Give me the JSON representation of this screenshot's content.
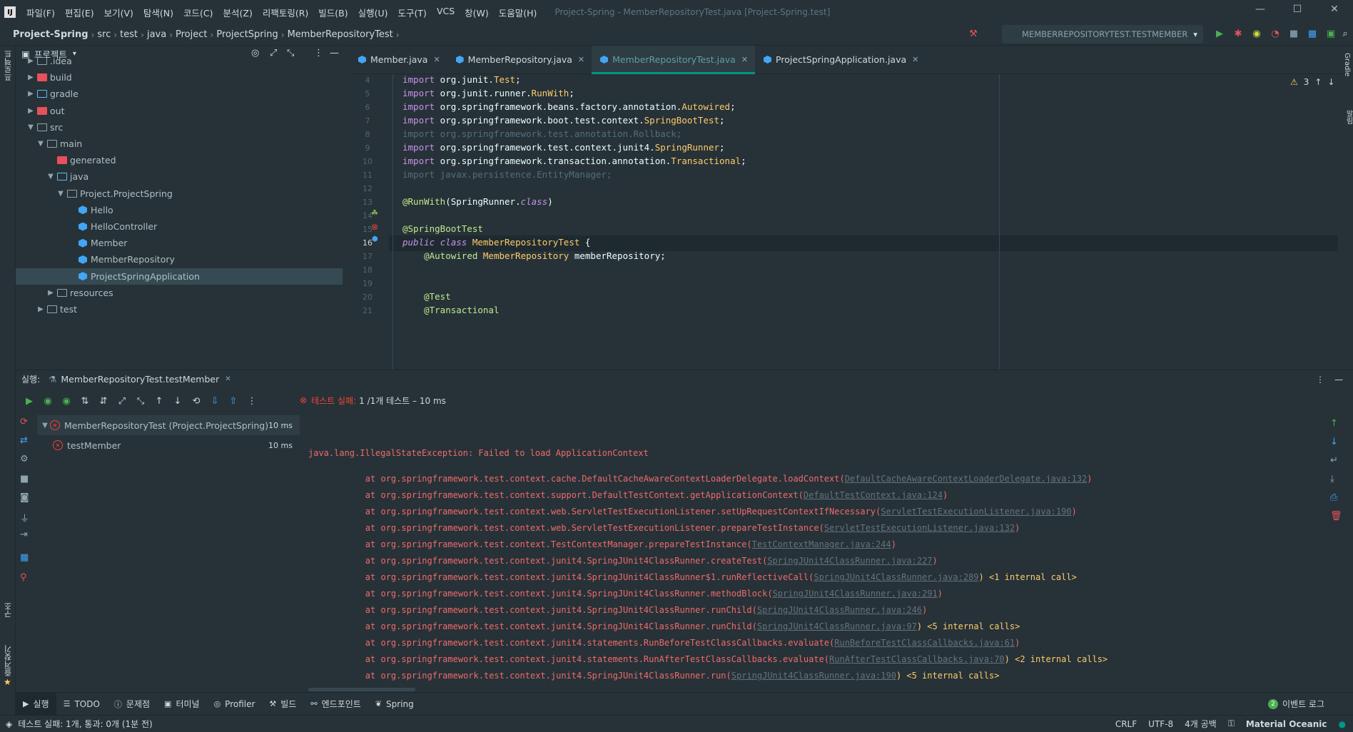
{
  "window": {
    "menus": [
      "파일(F)",
      "편집(E)",
      "보기(V)",
      "탐색(N)",
      "코드(C)",
      "분석(Z)",
      "리팩토링(R)",
      "빌드(B)",
      "실행(U)",
      "도구(T)",
      "VCS",
      "창(W)",
      "도움말(H)"
    ],
    "title": "Project-Spring - MemberRepositoryTest.java [Project-Spring.test]"
  },
  "breadcrumb": [
    "Project-Spring",
    "src",
    "test",
    "java",
    "Project",
    "ProjectSpring",
    "MemberRepositoryTest"
  ],
  "run_config": "MEMBERREPOSITORYTEST.TESTMEMBER",
  "project_panel": {
    "title": "프로젝트",
    "tree": [
      {
        "label": ".idea",
        "depth": 1,
        "kind": "folder",
        "arrow": "▶"
      },
      {
        "label": "build",
        "depth": 1,
        "kind": "folder-red",
        "arrow": "▶"
      },
      {
        "label": "gradle",
        "depth": 1,
        "kind": "folder-blue",
        "arrow": "▶"
      },
      {
        "label": "out",
        "depth": 1,
        "kind": "folder-red",
        "arrow": "▶"
      },
      {
        "label": "src",
        "depth": 1,
        "kind": "folder",
        "arrow": "▼"
      },
      {
        "label": "main",
        "depth": 2,
        "kind": "folder",
        "arrow": "▼"
      },
      {
        "label": "generated",
        "depth": 3,
        "kind": "folder-red",
        "arrow": ""
      },
      {
        "label": "java",
        "depth": 3,
        "kind": "folder-blue",
        "arrow": "▼"
      },
      {
        "label": "Project.ProjectSpring",
        "depth": 4,
        "kind": "folder",
        "arrow": "▼"
      },
      {
        "label": "Hello",
        "depth": 5,
        "kind": "class",
        "arrow": ""
      },
      {
        "label": "HelloController",
        "depth": 5,
        "kind": "class",
        "arrow": ""
      },
      {
        "label": "Member",
        "depth": 5,
        "kind": "class",
        "arrow": ""
      },
      {
        "label": "MemberRepository",
        "depth": 5,
        "kind": "class",
        "arrow": ""
      },
      {
        "label": "ProjectSpringApplication",
        "depth": 5,
        "kind": "class",
        "arrow": "",
        "selected": true
      },
      {
        "label": "resources",
        "depth": 3,
        "kind": "folder",
        "arrow": "▶"
      },
      {
        "label": "test",
        "depth": 2,
        "kind": "folder",
        "arrow": "▶"
      }
    ]
  },
  "editor_tabs": [
    {
      "label": "Member.java",
      "active": false
    },
    {
      "label": "MemberRepository.java",
      "active": false
    },
    {
      "label": "MemberRepositoryTest.java",
      "active": true
    },
    {
      "label": "ProjectSpringApplication.java",
      "active": false
    }
  ],
  "editor": {
    "warning_count": "3",
    "current_line": "16",
    "lines": [
      {
        "n": "4",
        "t": "import org.junit.Test;"
      },
      {
        "n": "5",
        "t": "import org.junit.runner.RunWith;"
      },
      {
        "n": "6",
        "t": "import org.springframework.beans.factory.annotation.Autowired;"
      },
      {
        "n": "7",
        "t": "import org.springframework.boot.test.context.SpringBootTest;"
      },
      {
        "n": "8",
        "t": "import org.springframework.test.annotation.Rollback;"
      },
      {
        "n": "9",
        "t": "import org.springframework.test.context.junit4.SpringRunner;"
      },
      {
        "n": "10",
        "t": "import org.springframework.transaction.annotation.Transactional;"
      },
      {
        "n": "11",
        "t": "import javax.persistence.EntityManager;"
      },
      {
        "n": "12",
        "t": ""
      },
      {
        "n": "13",
        "t": "@RunWith(SpringRunner.class)"
      },
      {
        "n": "14",
        "t": ""
      },
      {
        "n": "15",
        "t": "@SpringBootTest"
      },
      {
        "n": "16",
        "t": "public class MemberRepositoryTest {"
      },
      {
        "n": "17",
        "t": "    @Autowired MemberRepository memberRepository;"
      },
      {
        "n": "18",
        "t": ""
      },
      {
        "n": "19",
        "t": ""
      },
      {
        "n": "20",
        "t": "    @Test"
      },
      {
        "n": "21",
        "t": "    @Transactional"
      }
    ]
  },
  "run_panel": {
    "label": "실행:",
    "tab": "MemberRepositoryTest.testMember",
    "status_fail": "테스트 실패:",
    "status_rest": "1 /1개 테스트 – 10 ms",
    "tests": [
      {
        "label": "MemberRepositoryTest (Project.ProjectSpring)",
        "duration": "10 ms"
      },
      {
        "label": "testMember",
        "duration": "10 ms"
      }
    ],
    "console": [
      {
        "t": "java.lang.IllegalStateException: Failed to load ApplicationContext",
        "link": "",
        "extra": ""
      },
      {
        "t": "\tat org.springframework.test.context.cache.DefaultCacheAwareContextLoaderDelegate.loadContext(",
        "link": "DefaultCacheAwareContextLoaderDelegate.java:132",
        "extra": ")"
      },
      {
        "t": "\tat org.springframework.test.context.support.DefaultTestContext.getApplicationContext(",
        "link": "DefaultTestContext.java:124",
        "extra": ")"
      },
      {
        "t": "\tat org.springframework.test.context.web.ServletTestExecutionListener.setUpRequestContextIfNecessary(",
        "link": "ServletTestExecutionListener.java:190",
        "extra": ")"
      },
      {
        "t": "\tat org.springframework.test.context.web.ServletTestExecutionListener.prepareTestInstance(",
        "link": "ServletTestExecutionListener.java:132",
        "extra": ")"
      },
      {
        "t": "\tat org.springframework.test.context.TestContextManager.prepareTestInstance(",
        "link": "TestContextManager.java:244",
        "extra": ")"
      },
      {
        "t": "\tat org.springframework.test.context.junit4.SpringJUnit4ClassRunner.createTest(",
        "link": "SpringJUnit4ClassRunner.java:227",
        "extra": ")"
      },
      {
        "t": "\tat org.springframework.test.context.junit4.SpringJUnit4ClassRunner$1.runReflectiveCall(",
        "link": "SpringJUnit4ClassRunner.java:289",
        "extra": ") <1 internal call>"
      },
      {
        "t": "\tat org.springframework.test.context.junit4.SpringJUnit4ClassRunner.methodBlock(",
        "link": "SpringJUnit4ClassRunner.java:291",
        "extra": ")"
      },
      {
        "t": "\tat org.springframework.test.context.junit4.SpringJUnit4ClassRunner.runChild(",
        "link": "SpringJUnit4ClassRunner.java:246",
        "extra": ")"
      },
      {
        "t": "\tat org.springframework.test.context.junit4.SpringJUnit4ClassRunner.runChild(",
        "link": "SpringJUnit4ClassRunner.java:97",
        "extra": ") <5 internal calls>"
      },
      {
        "t": "\tat org.springframework.test.context.junit4.statements.RunBeforeTestClassCallbacks.evaluate(",
        "link": "RunBeforeTestClassCallbacks.java:61",
        "extra": ")"
      },
      {
        "t": "\tat org.springframework.test.context.junit4.statements.RunAfterTestClassCallbacks.evaluate(",
        "link": "RunAfterTestClassCallbacks.java:70",
        "extra": ") <2 internal calls>"
      },
      {
        "t": "\tat org.springframework.test.context.junit4.SpringJUnit4ClassRunner.run(",
        "link": "SpringJUnit4ClassRunner.java:190",
        "extra": ") <5 internal calls>"
      }
    ]
  },
  "left_strip": {
    "project": "프로젝트",
    "structure": "구조",
    "favorites": "즐겨찾기"
  },
  "right_strip": {
    "gradle": "Gradle",
    "notifications": "알림"
  },
  "tool_windows": [
    {
      "label": "실행",
      "icon": "▶",
      "active": true
    },
    {
      "label": "TODO",
      "icon": "☰",
      "active": false
    },
    {
      "label": "문제점",
      "icon": "ⓘ",
      "active": false
    },
    {
      "label": "터미널",
      "icon": "▣",
      "active": false
    },
    {
      "label": "Profiler",
      "icon": "◎",
      "active": false
    },
    {
      "label": "빌드",
      "icon": "⚒",
      "active": false
    },
    {
      "label": "엔드포인트",
      "icon": "⚯",
      "active": false
    },
    {
      "label": "Spring",
      "icon": "❦",
      "active": false
    }
  ],
  "event_log": {
    "count": "2",
    "label": "이벤트 로그"
  },
  "status": {
    "message": "테스트 실패: 1개, 통과: 0개 (1분 전)",
    "line_sep": "CRLF",
    "encoding": "UTF-8",
    "indent": "4개 공백",
    "theme": "Material Oceanic"
  }
}
